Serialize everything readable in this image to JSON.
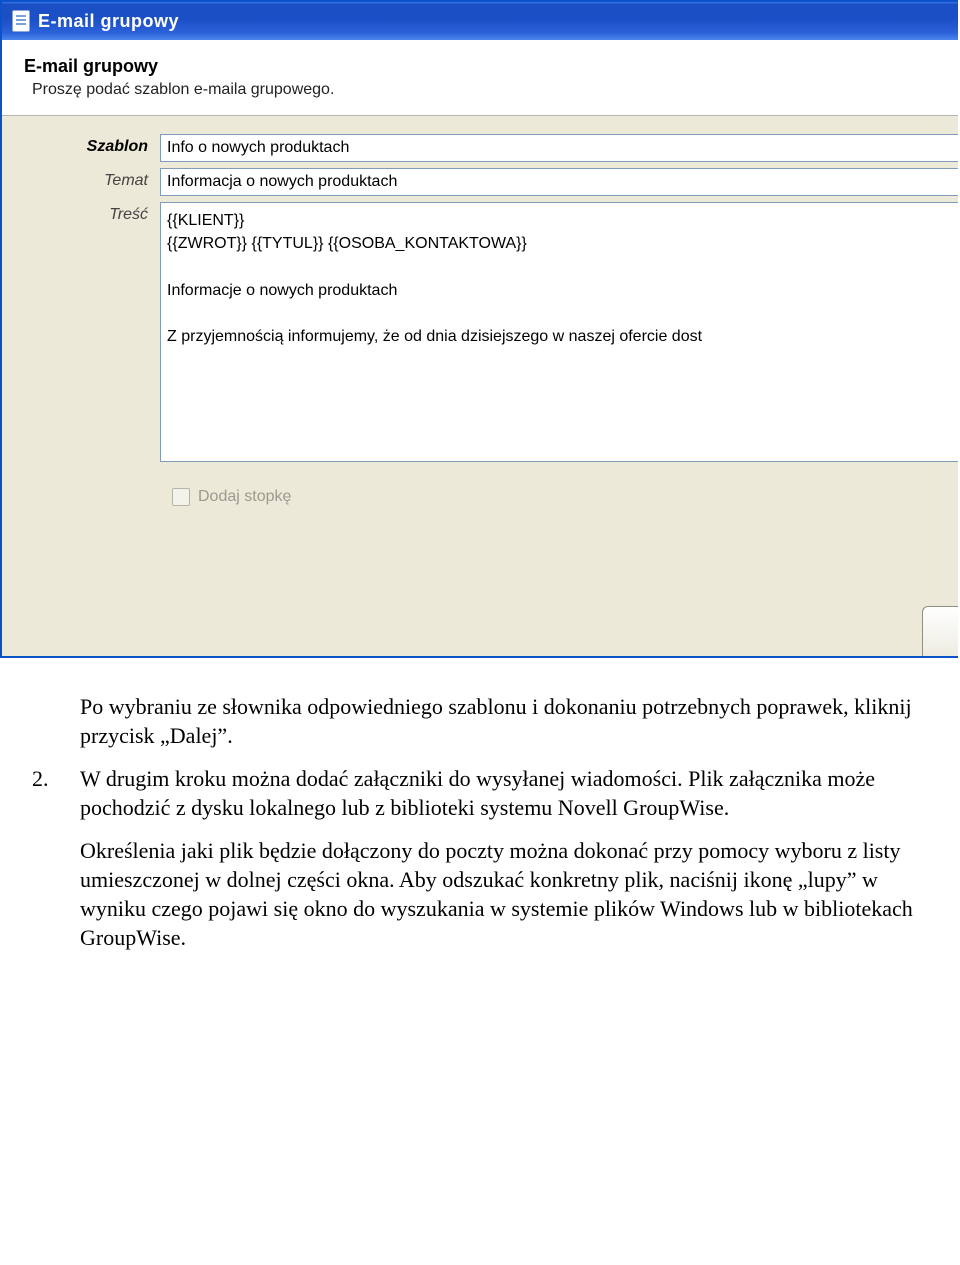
{
  "window": {
    "title": "E-mail grupowy"
  },
  "header": {
    "title": "E-mail grupowy",
    "subtitle": "Proszę podać szablon e-maila grupowego."
  },
  "form": {
    "labels": {
      "szablon": "Szablon",
      "temat": "Temat",
      "tresc": "Treść"
    },
    "szablon_value": "Info o nowych produktach",
    "temat_value": "Informacja o nowych produktach",
    "tresc_value": "{{KLIENT}}\n{{ZWROT}} {{TYTUL}} {{OSOBA_KONTAKTOWA}}\n\nInformacje o nowych produktach\n\nZ przyjemnością informujemy, że od dnia dzisiejszego w naszej ofercie dost",
    "checkbox_label": "Dodaj stopkę"
  },
  "body_text": {
    "p1": "Po wybraniu ze słownika odpowiedniego szablonu i dokonaniu potrzebnych poprawek, kliknij przycisk „Dalej”.",
    "n2": "2.",
    "p2": "W drugim kroku można dodać załączniki do wysyłanej wiadomości. Plik załącznika może pochodzić z dysku lokalnego lub z biblioteki systemu Novell GroupWise.",
    "p3": "Określenia jaki plik będzie dołączony do poczty można dokonać przy pomocy wyboru z listy umieszczonej w dolnej części okna. Aby odszukać konkretny plik, naciśnij ikonę „lupy” w wyniku czego pojawi się okno do wyszukania w systemie plików Windows lub w bibliotekach GroupWise."
  }
}
